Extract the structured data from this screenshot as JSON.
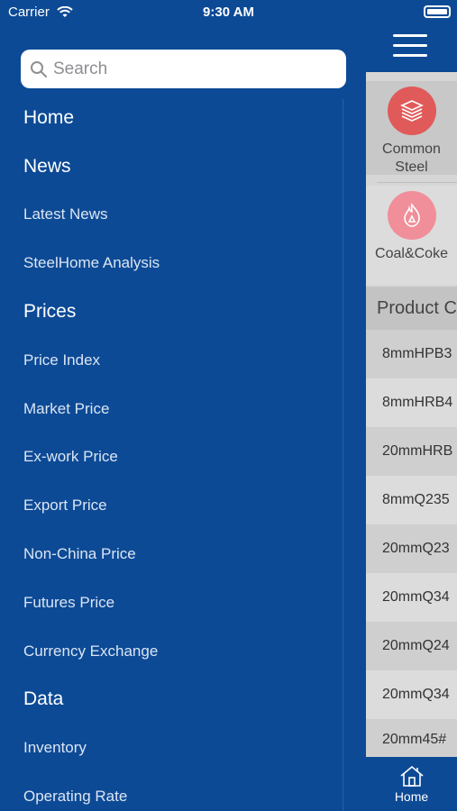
{
  "status": {
    "carrier": "Carrier",
    "time": "9:30 AM"
  },
  "search": {
    "placeholder": "Search"
  },
  "menu": [
    {
      "label": "Home",
      "type": "section"
    },
    {
      "label": "News",
      "type": "section"
    },
    {
      "label": "Latest News",
      "type": "sub"
    },
    {
      "label": "SteelHome Analysis",
      "type": "sub"
    },
    {
      "label": "Prices",
      "type": "section"
    },
    {
      "label": "Price Index",
      "type": "sub"
    },
    {
      "label": "Market Price",
      "type": "sub"
    },
    {
      "label": "Ex-work Price",
      "type": "sub"
    },
    {
      "label": "Export Price",
      "type": "sub"
    },
    {
      "label": "Non-China Price",
      "type": "sub"
    },
    {
      "label": "Futures Price",
      "type": "sub"
    },
    {
      "label": "Currency Exchange",
      "type": "sub"
    },
    {
      "label": "Data",
      "type": "section"
    },
    {
      "label": "Inventory",
      "type": "sub"
    },
    {
      "label": "Operating Rate",
      "type": "sub"
    }
  ],
  "categories": [
    {
      "label": "Common\nSteel",
      "icon": "steel-stack-icon"
    },
    {
      "label": "Coal&Coke",
      "icon": "coal-fire-icon"
    }
  ],
  "product_header": "Product C",
  "products": [
    "8mmHPB3",
    "8mmHRB4",
    "20mmHRB",
    "8mmQ235",
    "20mmQ23",
    "20mmQ34",
    "20mmQ24",
    "20mmQ34",
    "20mm45#"
  ],
  "tabbar": {
    "home_label": "Home"
  },
  "colors": {
    "drawer": "#0d4a96",
    "steel_icon": "#e05a5a",
    "coal_icon": "#f08e9a"
  }
}
